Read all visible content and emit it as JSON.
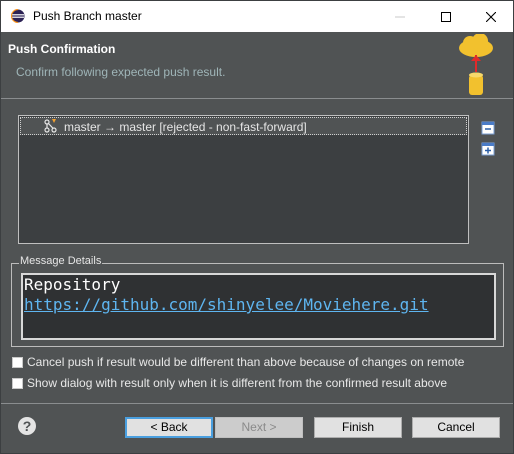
{
  "window": {
    "title": "Push Branch master"
  },
  "header": {
    "title": "Push Confirmation",
    "subtitle": "Confirm following expected push result."
  },
  "results": {
    "rows": [
      {
        "text": "master → master [rejected - non-fast-forward]"
      }
    ]
  },
  "message_details": {
    "legend": "Message Details",
    "line1": "Repository",
    "link": "https://github.com/shinyelee/Moviehere.git"
  },
  "options": {
    "cancel_if_different": {
      "label": "Cancel push if result would be different than above because of changes on remote",
      "checked": false
    },
    "show_only_if_different": {
      "label": "Show dialog with result only when it is different from the confirmed result above",
      "checked": false
    }
  },
  "buttons": {
    "help": "?",
    "back": "< Back",
    "next": "Next >",
    "finish": "Finish",
    "cancel": "Cancel"
  },
  "colors": {
    "dialog_bg": "#505354",
    "link": "#5eb5f0",
    "subtitle": "#9fb5b8",
    "default_button_border": "#4a9fdf"
  },
  "icons": {
    "app": "eclipse-icon",
    "push_image": "cloud-upload-icon",
    "row": "branch-push-icon",
    "tool1": "collapse-all-icon",
    "tool2": "expand-all-icon"
  }
}
